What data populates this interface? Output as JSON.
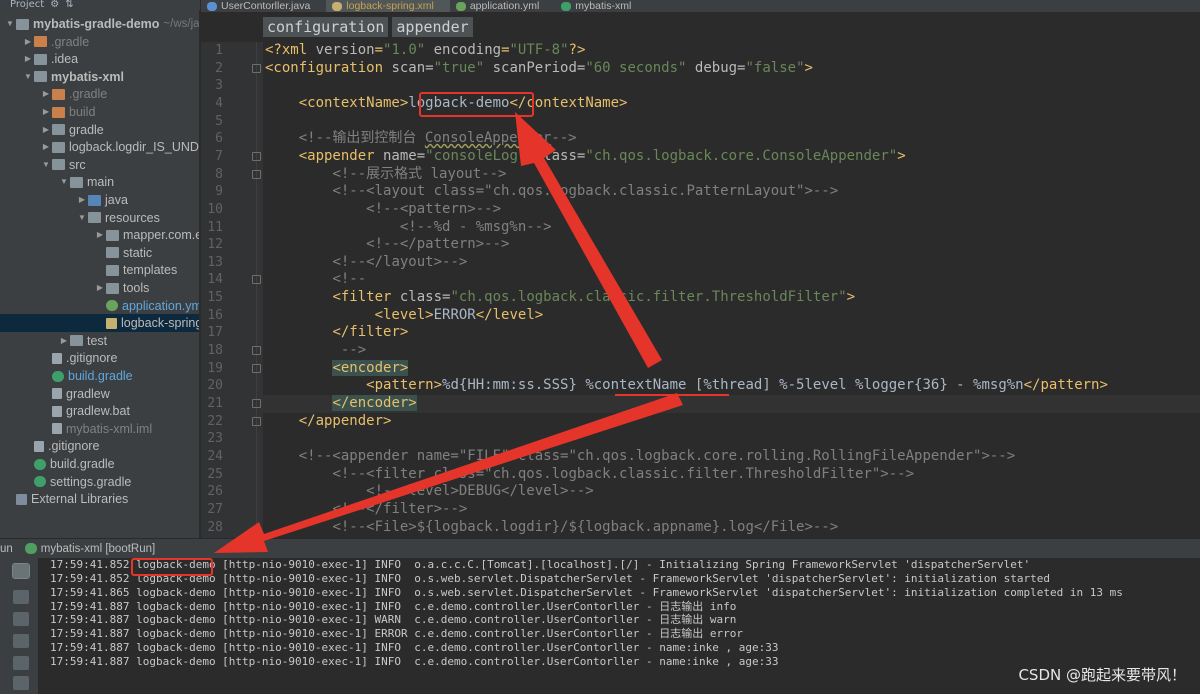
{
  "project": {
    "header": [
      "Project",
      "⚙",
      "⇅"
    ],
    "items": [
      {
        "arrow": "▼",
        "icon": "folder",
        "label": "mybatis-gradle-demo",
        "hint": "~/ws/ja",
        "bold": true
      },
      {
        "arrow": "▶",
        "icon": "folder orange",
        "label": ".gradle",
        "dim": true
      },
      {
        "arrow": "▶",
        "icon": "folder",
        "label": ".idea"
      },
      {
        "arrow": "▼",
        "icon": "folder",
        "label": "mybatis-xml",
        "bold": true
      },
      {
        "arrow": "▶",
        "icon": "folder orange",
        "label": ".gradle",
        "dim": true
      },
      {
        "arrow": "▶",
        "icon": "folder orange",
        "label": "build",
        "dim": true
      },
      {
        "arrow": "▶",
        "icon": "folder",
        "label": "gradle"
      },
      {
        "arrow": "▶",
        "icon": "folder",
        "label": "logback.logdir_IS_UNDEF"
      },
      {
        "arrow": "▼",
        "icon": "folder",
        "label": "src"
      },
      {
        "arrow": "▼",
        "icon": "folder",
        "label": "main"
      },
      {
        "arrow": "▶",
        "icon": "folder blue",
        "label": "java"
      },
      {
        "arrow": "▼",
        "icon": "folder",
        "label": "resources"
      },
      {
        "arrow": "▶",
        "icon": "folder",
        "label": "mapper.com.ex"
      },
      {
        "arrow": "",
        "icon": "folder",
        "label": "static"
      },
      {
        "arrow": "",
        "icon": "folder",
        "label": "templates"
      },
      {
        "arrow": "▶",
        "icon": "folder",
        "label": "tools"
      },
      {
        "arrow": "",
        "icon": "yml",
        "label": "application.yml",
        "color": "blue"
      },
      {
        "arrow": "",
        "icon": "xml",
        "label": "logback-spring",
        "selected": true
      },
      {
        "arrow": "▶",
        "icon": "folder",
        "label": "test"
      },
      {
        "arrow": "",
        "icon": "file",
        "label": ".gitignore"
      },
      {
        "arrow": "",
        "icon": "gradle",
        "label": "build.gradle",
        "color": "blue"
      },
      {
        "arrow": "",
        "icon": "file",
        "label": "gradlew"
      },
      {
        "arrow": "",
        "icon": "file",
        "label": "gradlew.bat"
      },
      {
        "arrow": "",
        "icon": "file",
        "label": "mybatis-xml.iml",
        "dim": true
      },
      {
        "arrow": "",
        "icon": "file",
        "label": ".gitignore"
      },
      {
        "arrow": "",
        "icon": "gradle",
        "label": "build.gradle"
      },
      {
        "arrow": "",
        "icon": "gradle",
        "label": "settings.gradle"
      },
      {
        "arrow": "",
        "icon": "lib",
        "label": "External Libraries"
      }
    ]
  },
  "tabs": [
    {
      "label": "UserContorller.java",
      "icon_color": "#5b8fd1",
      "icon": "java-class-icon"
    },
    {
      "label": "logback-spring.xml",
      "icon_color": "#c6b06f",
      "icon": "xml-file-icon",
      "active": true
    },
    {
      "label": "application.yml",
      "icon_color": "#6aa35c",
      "icon": "yml-file-icon"
    },
    {
      "label": "mybatis-xml",
      "icon_color": "#3f9f6a",
      "icon": "gradle-icon"
    }
  ],
  "breadcrumb": [
    "configuration",
    "appender"
  ],
  "editor": {
    "line_numbers": [
      "1",
      "2",
      "3",
      "4",
      "5",
      "6",
      "7",
      "8",
      "9",
      "10",
      "11",
      "12",
      "13",
      "14",
      "15",
      "16",
      "17",
      "18",
      "19",
      "20",
      "21",
      "22",
      "23",
      "24",
      "25",
      "26",
      "27",
      "28"
    ],
    "lines": [
      "<?xml version=\"1.0\" encoding=\"UTF-8\"?>",
      "<configuration scan=\"true\" scanPeriod=\"60 seconds\" debug=\"false\">",
      "",
      "    <contextName>logback-demo</contextName>",
      "",
      "    <!--输出到控制台 ConsoleAppender-->",
      "    <appender name=\"consoleLog\" class=\"ch.qos.logback.core.ConsoleAppender\">",
      "        <!--展示格式 layout-->",
      "        <!--<layout class=\"ch.qos.logback.classic.PatternLayout\">-->",
      "            <!--<pattern>-->",
      "                <!--%d - %msg%n-->",
      "            <!--</pattern>-->",
      "        <!--</layout>-->",
      "        <!--",
      "        <filter class=\"ch.qos.logback.classic.filter.ThresholdFilter\">",
      "             <level>ERROR</level>",
      "        </filter>",
      "         -->",
      "        <encoder>",
      "            <pattern>%d{HH:mm:ss.SSS} %contextName [%thread] %-5level %logger{36} - %msg%n</pattern>",
      "        </encoder>",
      "    </appender>",
      "",
      "    <!--<appender name=\"FILE\" class=\"ch.qos.logback.core.rolling.RollingFileAppender\">-->",
      "        <!--<filter class=\"ch.qos.logback.classic.filter.ThresholdFilter\">-->",
      "            <!--<level>DEBUG</level>-->",
      "        <!--</filter>-->",
      "        <!--<File>${logback.logdir}/${logback.appname}.log</File>-->"
    ]
  },
  "run": {
    "title": "mybatis-xml [bootRun]",
    "prefix": "un",
    "logs": [
      "17:59:41.852 logback-demo [http-nio-9010-exec-1] INFO  o.a.c.c.C.[Tomcat].[localhost].[/] - Initializing Spring FrameworkServlet 'dispatcherServlet'",
      "17:59:41.852 logback-demo [http-nio-9010-exec-1] INFO  o.s.web.servlet.DispatcherServlet - FrameworkServlet 'dispatcherServlet': initialization started",
      "17:59:41.865 logback-demo [http-nio-9010-exec-1] INFO  o.s.web.servlet.DispatcherServlet - FrameworkServlet 'dispatcherServlet': initialization completed in 13 ms",
      "17:59:41.887 logback-demo [http-nio-9010-exec-1] INFO  c.e.demo.controller.UserContorller - 日志输出 info",
      "17:59:41.887 logback-demo [http-nio-9010-exec-1] WARN  c.e.demo.controller.UserContorller - 日志输出 warn",
      "17:59:41.887 logback-demo [http-nio-9010-exec-1] ERROR c.e.demo.controller.UserContorller - 日志输出 error",
      "17:59:41.887 logback-demo [http-nio-9010-exec-1] INFO  c.e.demo.controller.UserContorller - name:inke , age:33",
      "17:59:41.887 logback-demo [http-nio-9010-exec-1] INFO  c.e.demo.controller.UserContorller - name:inke , age:33"
    ]
  },
  "watermark": "CSDN @跑起来要带风！",
  "colors": {
    "annotation": "#e5352b",
    "tag": "#e8bf6a",
    "string": "#6a8759",
    "comment": "#808080"
  }
}
